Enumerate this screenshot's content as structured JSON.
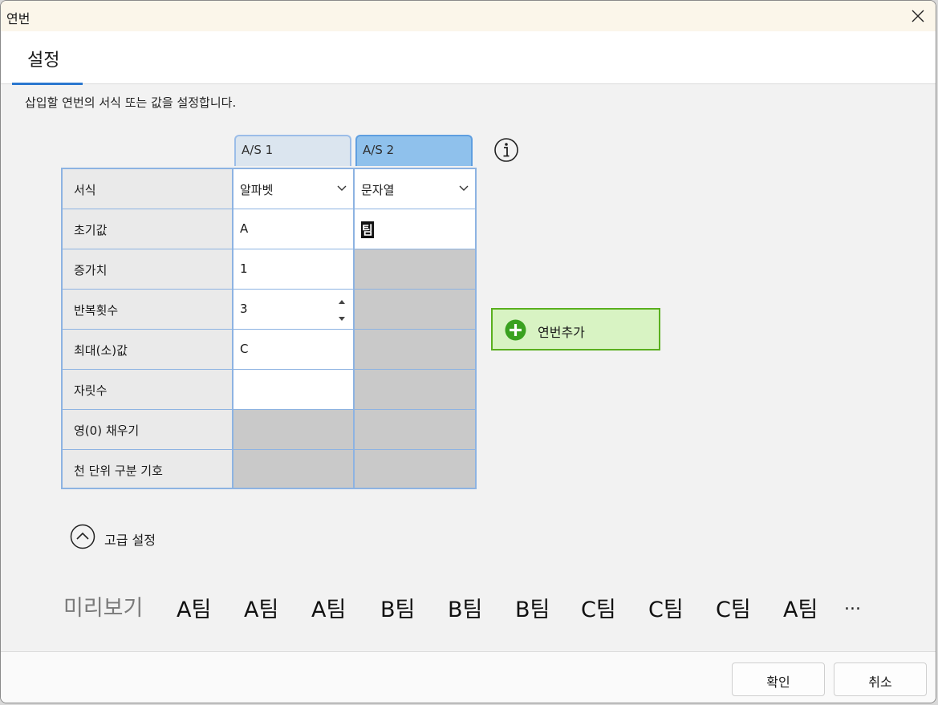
{
  "window": {
    "title": "연번"
  },
  "tabs": [
    {
      "label": "설정",
      "active": true
    }
  ],
  "description": "삽입할 연번의 서식 또는 값을 설정합니다.",
  "columns": [
    "A/S 1",
    "A/S 2"
  ],
  "grid": {
    "rows": [
      {
        "label": "서식",
        "c1": "알파벳",
        "c2": "문자열"
      },
      {
        "label": "초기값",
        "c1": "A",
        "c2": "팀"
      },
      {
        "label": "증가치",
        "c1": "1",
        "c2": ""
      },
      {
        "label": "반복횟수",
        "c1": "3",
        "c2": ""
      },
      {
        "label": "최대(소)값",
        "c1": "C",
        "c2": ""
      },
      {
        "label": "자릿수",
        "c1": "",
        "c2": ""
      },
      {
        "label": "영(0) 채우기",
        "c1": "",
        "c2": ""
      },
      {
        "label": "천 단위 구분 기호",
        "c1": "",
        "c2": ""
      }
    ]
  },
  "add_button": {
    "label": "연번추가"
  },
  "advanced": {
    "label": "고급 설정"
  },
  "preview": {
    "label": "미리보기",
    "items": [
      "A팀",
      "A팀",
      "A팀",
      "B팀",
      "B팀",
      "B팀",
      "C팀",
      "C팀",
      "C팀",
      "A팀"
    ],
    "more": "..."
  },
  "footer": {
    "ok_label": "확인",
    "cancel_label": "취소"
  },
  "colors": {
    "accent": "#2a77cf",
    "add_green": "#5aaf1e",
    "add_bg": "#d8f3c3",
    "grid_border": "#8db3e2",
    "disabled_cell": "#c9c9c9"
  }
}
